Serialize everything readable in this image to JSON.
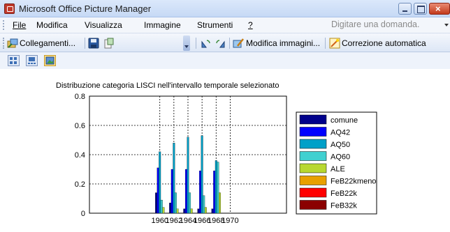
{
  "window": {
    "title": "Microsoft Office Picture Manager",
    "close_glyph": "×"
  },
  "menu": {
    "items": [
      "File",
      "Modifica",
      "Visualizza",
      "Immagine",
      "Strumenti",
      "?"
    ],
    "help_placeholder": "Digitare una domanda."
  },
  "toolbar": {
    "shortcuts_label": "Collegamenti...",
    "edit_label": "Modifica immagini...",
    "autocorrect_label": "Correzione automatica",
    "icons": [
      "shortcuts-icon",
      "save-icon",
      "export-icon",
      "rotate-left-icon",
      "rotate-right-icon",
      "edit-pictures-icon",
      "auto-correct-icon"
    ]
  },
  "view_buttons": [
    "thumbnails-view-icon",
    "filmstrip-view-icon",
    "single-picture-view-icon"
  ],
  "colors": {
    "comune": "#00008b",
    "AQ42": "#0000ff",
    "AQ50": "#00a0c8",
    "AQ60": "#40d0d0",
    "ALE": "#b8d830",
    "FeB22kmeno": "#e8a000",
    "FeB22k": "#ff0000",
    "FeB32k": "#8b0000"
  },
  "chart_data": {
    "type": "bar",
    "title": "Distribuzione categoria LISCI nell'intervallo temporale selezionato",
    "xlabel": "",
    "ylabel": "",
    "ylim": [
      0,
      0.8
    ],
    "yticks": [
      "0",
      "0.2",
      "0.4",
      "0.6",
      "0.8"
    ],
    "xlim": [
      1950,
      1978
    ],
    "xticks": [
      "1960",
      "1962",
      "1964",
      "1966",
      "1968",
      "1970"
    ],
    "categories": [
      1960,
      1962,
      1964,
      1966,
      1968
    ],
    "grid": true,
    "legend_position": "right",
    "series": [
      {
        "name": "comune",
        "values": [
          0.14,
          0.07,
          0.03,
          0.03,
          0.03
        ]
      },
      {
        "name": "AQ42",
        "values": [
          0.31,
          0.3,
          0.3,
          0.29,
          0.29
        ]
      },
      {
        "name": "AQ50",
        "values": [
          0.42,
          0.48,
          0.52,
          0.53,
          0.36
        ]
      },
      {
        "name": "AQ60",
        "values": [
          0.09,
          0.14,
          0.14,
          0.12,
          0.35
        ]
      },
      {
        "name": "ALE",
        "values": [
          0.04,
          0.03,
          0.03,
          0.04,
          0.14
        ]
      },
      {
        "name": "FeB22kmeno",
        "values": [
          0,
          0,
          0,
          0,
          0
        ]
      },
      {
        "name": "FeB22k",
        "values": [
          0,
          0,
          0,
          0,
          0
        ]
      },
      {
        "name": "FeB32k",
        "values": [
          0,
          0,
          0,
          0,
          0
        ]
      }
    ]
  }
}
